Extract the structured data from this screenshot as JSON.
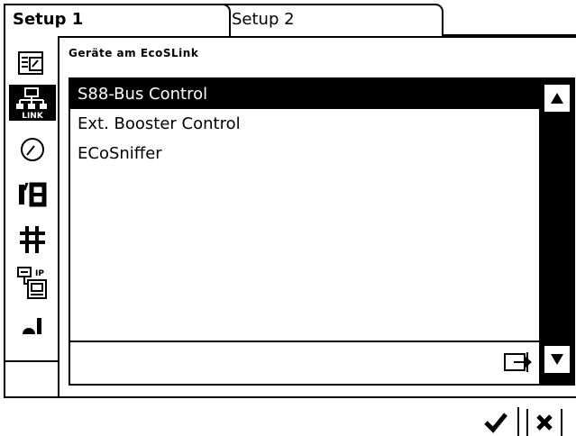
{
  "tabs": [
    {
      "label": "Setup 1",
      "active": true
    },
    {
      "label": "Setup 2",
      "active": false
    }
  ],
  "sidebar": {
    "items": [
      {
        "icon": "device-settings-icon",
        "active": false
      },
      {
        "icon": "ecoslink-network-icon",
        "active": true
      },
      {
        "icon": "gauge-icon",
        "active": false
      },
      {
        "icon": "io-icon",
        "active": false
      },
      {
        "icon": "track-grid-icon",
        "active": false
      },
      {
        "icon": "ip-network-icon",
        "active": false
      },
      {
        "icon": "signal-bars-icon",
        "active": false
      }
    ]
  },
  "section": {
    "title": "Geräte am EcoSLink"
  },
  "device_list": {
    "items": [
      {
        "label": "S88-Bus Control",
        "selected": true
      },
      {
        "label": "Ext. Booster Control",
        "selected": false
      },
      {
        "label": "ECoSniffer",
        "selected": false
      }
    ]
  },
  "colors": {
    "foreground": "#000000",
    "background": "#ffffff"
  }
}
